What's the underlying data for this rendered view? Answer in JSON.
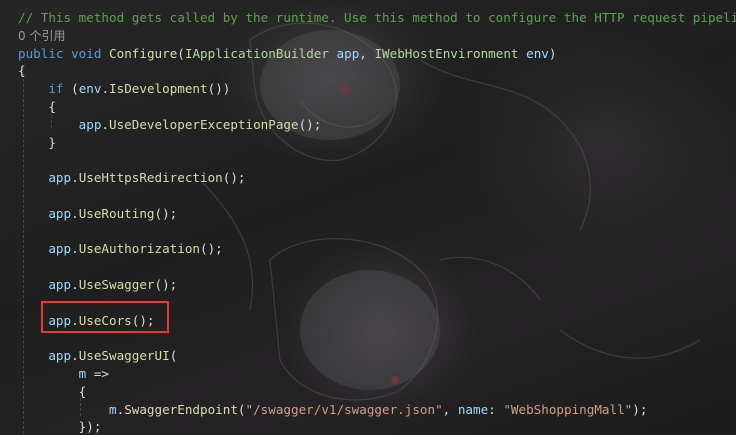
{
  "editor": {
    "lines": [
      {
        "id": "l1",
        "tokens": [
          {
            "t": "// This method gets called by the runtime. Use this method to configure the HTTP request pipeline.",
            "c": "comment"
          }
        ]
      },
      {
        "id": "l2",
        "tokens": [
          {
            "t": "0 个引用",
            "c": "codelens"
          }
        ]
      },
      {
        "id": "l3",
        "tokens": [
          {
            "t": "public",
            "c": "keyword"
          },
          {
            "t": " ",
            "c": "plain"
          },
          {
            "t": "void",
            "c": "keyword"
          },
          {
            "t": " ",
            "c": "plain"
          },
          {
            "t": "Configure",
            "c": "method"
          },
          {
            "t": "(",
            "c": "plain"
          },
          {
            "t": "IApplicationBuilder",
            "c": "type"
          },
          {
            "t": " ",
            "c": "plain"
          },
          {
            "t": "app",
            "c": "ident"
          },
          {
            "t": ", ",
            "c": "plain"
          },
          {
            "t": "IWebHostEnvironment",
            "c": "type"
          },
          {
            "t": " ",
            "c": "plain"
          },
          {
            "t": "env",
            "c": "ident"
          },
          {
            "t": ")",
            "c": "plain"
          }
        ]
      },
      {
        "id": "l4",
        "tokens": [
          {
            "t": "{",
            "c": "plain"
          }
        ]
      },
      {
        "id": "l5",
        "tokens": [
          {
            "t": "    ",
            "c": "plain"
          },
          {
            "t": "if",
            "c": "keyword"
          },
          {
            "t": " (",
            "c": "plain"
          },
          {
            "t": "env",
            "c": "ident"
          },
          {
            "t": ".",
            "c": "plain"
          },
          {
            "t": "IsDevelopment",
            "c": "method"
          },
          {
            "t": "())",
            "c": "plain"
          }
        ]
      },
      {
        "id": "l6",
        "tokens": [
          {
            "t": "    {",
            "c": "plain"
          }
        ]
      },
      {
        "id": "l7",
        "tokens": [
          {
            "t": "        ",
            "c": "plain"
          },
          {
            "t": "app",
            "c": "ident"
          },
          {
            "t": ".",
            "c": "plain"
          },
          {
            "t": "UseDeveloperExceptionPage",
            "c": "method"
          },
          {
            "t": "();",
            "c": "plain"
          }
        ]
      },
      {
        "id": "l8",
        "tokens": [
          {
            "t": "    }",
            "c": "plain"
          }
        ]
      },
      {
        "id": "l9",
        "tokens": [
          {
            "t": "",
            "c": "plain"
          }
        ]
      },
      {
        "id": "l10",
        "tokens": [
          {
            "t": "    ",
            "c": "plain"
          },
          {
            "t": "app",
            "c": "ident"
          },
          {
            "t": ".",
            "c": "plain"
          },
          {
            "t": "UseHttpsRedirection",
            "c": "method"
          },
          {
            "t": "();",
            "c": "plain"
          }
        ]
      },
      {
        "id": "l11",
        "tokens": [
          {
            "t": "",
            "c": "plain"
          }
        ]
      },
      {
        "id": "l12",
        "tokens": [
          {
            "t": "    ",
            "c": "plain"
          },
          {
            "t": "app",
            "c": "ident"
          },
          {
            "t": ".",
            "c": "plain"
          },
          {
            "t": "UseRouting",
            "c": "method"
          },
          {
            "t": "();",
            "c": "plain"
          }
        ]
      },
      {
        "id": "l13",
        "tokens": [
          {
            "t": "",
            "c": "plain"
          }
        ]
      },
      {
        "id": "l14",
        "tokens": [
          {
            "t": "    ",
            "c": "plain"
          },
          {
            "t": "app",
            "c": "ident"
          },
          {
            "t": ".",
            "c": "plain"
          },
          {
            "t": "UseAuthorization",
            "c": "method"
          },
          {
            "t": "();",
            "c": "plain"
          }
        ]
      },
      {
        "id": "l15",
        "tokens": [
          {
            "t": "",
            "c": "plain"
          }
        ]
      },
      {
        "id": "l16",
        "tokens": [
          {
            "t": "    ",
            "c": "plain"
          },
          {
            "t": "app",
            "c": "ident"
          },
          {
            "t": ".",
            "c": "plain"
          },
          {
            "t": "UseSwagger",
            "c": "method"
          },
          {
            "t": "();",
            "c": "plain"
          }
        ]
      },
      {
        "id": "l17",
        "tokens": [
          {
            "t": "",
            "c": "plain"
          }
        ]
      },
      {
        "id": "l18",
        "tokens": [
          {
            "t": "    ",
            "c": "plain"
          },
          {
            "t": "app",
            "c": "ident"
          },
          {
            "t": ".",
            "c": "plain"
          },
          {
            "t": "UseCors",
            "c": "method"
          },
          {
            "t": "();",
            "c": "plain"
          }
        ]
      },
      {
        "id": "l19",
        "tokens": [
          {
            "t": "",
            "c": "plain"
          }
        ]
      },
      {
        "id": "l20",
        "tokens": [
          {
            "t": "    ",
            "c": "plain"
          },
          {
            "t": "app",
            "c": "ident"
          },
          {
            "t": ".",
            "c": "plain"
          },
          {
            "t": "UseSwaggerUI",
            "c": "method"
          },
          {
            "t": "(",
            "c": "plain"
          }
        ]
      },
      {
        "id": "l21",
        "tokens": [
          {
            "t": "        ",
            "c": "plain"
          },
          {
            "t": "m",
            "c": "ident"
          },
          {
            "t": " =>",
            "c": "plain"
          }
        ]
      },
      {
        "id": "l22",
        "tokens": [
          {
            "t": "        {",
            "c": "plain"
          }
        ]
      },
      {
        "id": "l23",
        "tokens": [
          {
            "t": "            ",
            "c": "plain"
          },
          {
            "t": "m",
            "c": "ident"
          },
          {
            "t": ".",
            "c": "plain"
          },
          {
            "t": "SwaggerEndpoint",
            "c": "method"
          },
          {
            "t": "(",
            "c": "plain"
          },
          {
            "t": "\"/swagger/v1/swagger.json\"",
            "c": "string"
          },
          {
            "t": ", ",
            "c": "plain"
          },
          {
            "t": "name",
            "c": "ident"
          },
          {
            "t": ": ",
            "c": "plain"
          },
          {
            "t": "\"WebShoppingMall\"",
            "c": "string"
          },
          {
            "t": ");",
            "c": "plain"
          }
        ]
      },
      {
        "id": "l24",
        "tokens": [
          {
            "t": "        });",
            "c": "plain"
          }
        ]
      }
    ],
    "highlight": {
      "label": "annotation-box",
      "color": "#e53935"
    },
    "colors": {
      "comment": "#57a64a",
      "keyword": "#569cd6",
      "method": "#dcdcaa",
      "type": "#b8d7a3",
      "ident": "#9cdcfe",
      "string": "#d69d85",
      "plain": "#dcdcdc"
    }
  }
}
